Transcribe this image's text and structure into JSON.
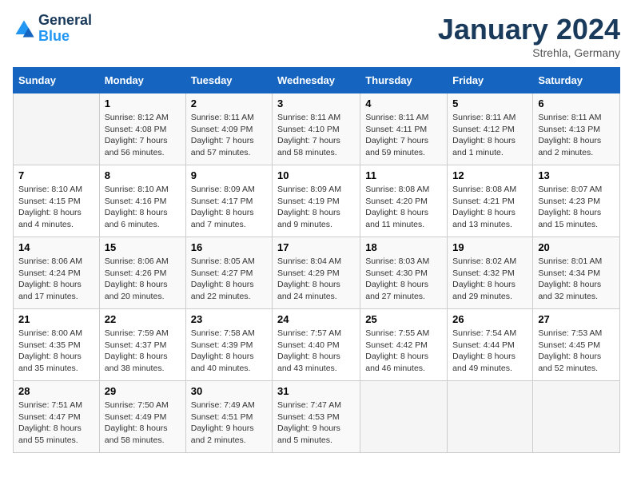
{
  "header": {
    "logo_line1": "General",
    "logo_line2": "Blue",
    "month_year": "January 2024",
    "location": "Strehla, Germany"
  },
  "days_of_week": [
    "Sunday",
    "Monday",
    "Tuesday",
    "Wednesday",
    "Thursday",
    "Friday",
    "Saturday"
  ],
  "weeks": [
    [
      {
        "day": "",
        "empty": true
      },
      {
        "day": "1",
        "sunrise": "Sunrise: 8:12 AM",
        "sunset": "Sunset: 4:08 PM",
        "daylight": "Daylight: 7 hours and 56 minutes."
      },
      {
        "day": "2",
        "sunrise": "Sunrise: 8:11 AM",
        "sunset": "Sunset: 4:09 PM",
        "daylight": "Daylight: 7 hours and 57 minutes."
      },
      {
        "day": "3",
        "sunrise": "Sunrise: 8:11 AM",
        "sunset": "Sunset: 4:10 PM",
        "daylight": "Daylight: 7 hours and 58 minutes."
      },
      {
        "day": "4",
        "sunrise": "Sunrise: 8:11 AM",
        "sunset": "Sunset: 4:11 PM",
        "daylight": "Daylight: 7 hours and 59 minutes."
      },
      {
        "day": "5",
        "sunrise": "Sunrise: 8:11 AM",
        "sunset": "Sunset: 4:12 PM",
        "daylight": "Daylight: 8 hours and 1 minute."
      },
      {
        "day": "6",
        "sunrise": "Sunrise: 8:11 AM",
        "sunset": "Sunset: 4:13 PM",
        "daylight": "Daylight: 8 hours and 2 minutes."
      }
    ],
    [
      {
        "day": "7",
        "sunrise": "Sunrise: 8:10 AM",
        "sunset": "Sunset: 4:15 PM",
        "daylight": "Daylight: 8 hours and 4 minutes."
      },
      {
        "day": "8",
        "sunrise": "Sunrise: 8:10 AM",
        "sunset": "Sunset: 4:16 PM",
        "daylight": "Daylight: 8 hours and 6 minutes."
      },
      {
        "day": "9",
        "sunrise": "Sunrise: 8:09 AM",
        "sunset": "Sunset: 4:17 PM",
        "daylight": "Daylight: 8 hours and 7 minutes."
      },
      {
        "day": "10",
        "sunrise": "Sunrise: 8:09 AM",
        "sunset": "Sunset: 4:19 PM",
        "daylight": "Daylight: 8 hours and 9 minutes."
      },
      {
        "day": "11",
        "sunrise": "Sunrise: 8:08 AM",
        "sunset": "Sunset: 4:20 PM",
        "daylight": "Daylight: 8 hours and 11 minutes."
      },
      {
        "day": "12",
        "sunrise": "Sunrise: 8:08 AM",
        "sunset": "Sunset: 4:21 PM",
        "daylight": "Daylight: 8 hours and 13 minutes."
      },
      {
        "day": "13",
        "sunrise": "Sunrise: 8:07 AM",
        "sunset": "Sunset: 4:23 PM",
        "daylight": "Daylight: 8 hours and 15 minutes."
      }
    ],
    [
      {
        "day": "14",
        "sunrise": "Sunrise: 8:06 AM",
        "sunset": "Sunset: 4:24 PM",
        "daylight": "Daylight: 8 hours and 17 minutes."
      },
      {
        "day": "15",
        "sunrise": "Sunrise: 8:06 AM",
        "sunset": "Sunset: 4:26 PM",
        "daylight": "Daylight: 8 hours and 20 minutes."
      },
      {
        "day": "16",
        "sunrise": "Sunrise: 8:05 AM",
        "sunset": "Sunset: 4:27 PM",
        "daylight": "Daylight: 8 hours and 22 minutes."
      },
      {
        "day": "17",
        "sunrise": "Sunrise: 8:04 AM",
        "sunset": "Sunset: 4:29 PM",
        "daylight": "Daylight: 8 hours and 24 minutes."
      },
      {
        "day": "18",
        "sunrise": "Sunrise: 8:03 AM",
        "sunset": "Sunset: 4:30 PM",
        "daylight": "Daylight: 8 hours and 27 minutes."
      },
      {
        "day": "19",
        "sunrise": "Sunrise: 8:02 AM",
        "sunset": "Sunset: 4:32 PM",
        "daylight": "Daylight: 8 hours and 29 minutes."
      },
      {
        "day": "20",
        "sunrise": "Sunrise: 8:01 AM",
        "sunset": "Sunset: 4:34 PM",
        "daylight": "Daylight: 8 hours and 32 minutes."
      }
    ],
    [
      {
        "day": "21",
        "sunrise": "Sunrise: 8:00 AM",
        "sunset": "Sunset: 4:35 PM",
        "daylight": "Daylight: 8 hours and 35 minutes."
      },
      {
        "day": "22",
        "sunrise": "Sunrise: 7:59 AM",
        "sunset": "Sunset: 4:37 PM",
        "daylight": "Daylight: 8 hours and 38 minutes."
      },
      {
        "day": "23",
        "sunrise": "Sunrise: 7:58 AM",
        "sunset": "Sunset: 4:39 PM",
        "daylight": "Daylight: 8 hours and 40 minutes."
      },
      {
        "day": "24",
        "sunrise": "Sunrise: 7:57 AM",
        "sunset": "Sunset: 4:40 PM",
        "daylight": "Daylight: 8 hours and 43 minutes."
      },
      {
        "day": "25",
        "sunrise": "Sunrise: 7:55 AM",
        "sunset": "Sunset: 4:42 PM",
        "daylight": "Daylight: 8 hours and 46 minutes."
      },
      {
        "day": "26",
        "sunrise": "Sunrise: 7:54 AM",
        "sunset": "Sunset: 4:44 PM",
        "daylight": "Daylight: 8 hours and 49 minutes."
      },
      {
        "day": "27",
        "sunrise": "Sunrise: 7:53 AM",
        "sunset": "Sunset: 4:45 PM",
        "daylight": "Daylight: 8 hours and 52 minutes."
      }
    ],
    [
      {
        "day": "28",
        "sunrise": "Sunrise: 7:51 AM",
        "sunset": "Sunset: 4:47 PM",
        "daylight": "Daylight: 8 hours and 55 minutes."
      },
      {
        "day": "29",
        "sunrise": "Sunrise: 7:50 AM",
        "sunset": "Sunset: 4:49 PM",
        "daylight": "Daylight: 8 hours and 58 minutes."
      },
      {
        "day": "30",
        "sunrise": "Sunrise: 7:49 AM",
        "sunset": "Sunset: 4:51 PM",
        "daylight": "Daylight: 9 hours and 2 minutes."
      },
      {
        "day": "31",
        "sunrise": "Sunrise: 7:47 AM",
        "sunset": "Sunset: 4:53 PM",
        "daylight": "Daylight: 9 hours and 5 minutes."
      },
      {
        "day": "",
        "empty": true
      },
      {
        "day": "",
        "empty": true
      },
      {
        "day": "",
        "empty": true
      }
    ]
  ]
}
